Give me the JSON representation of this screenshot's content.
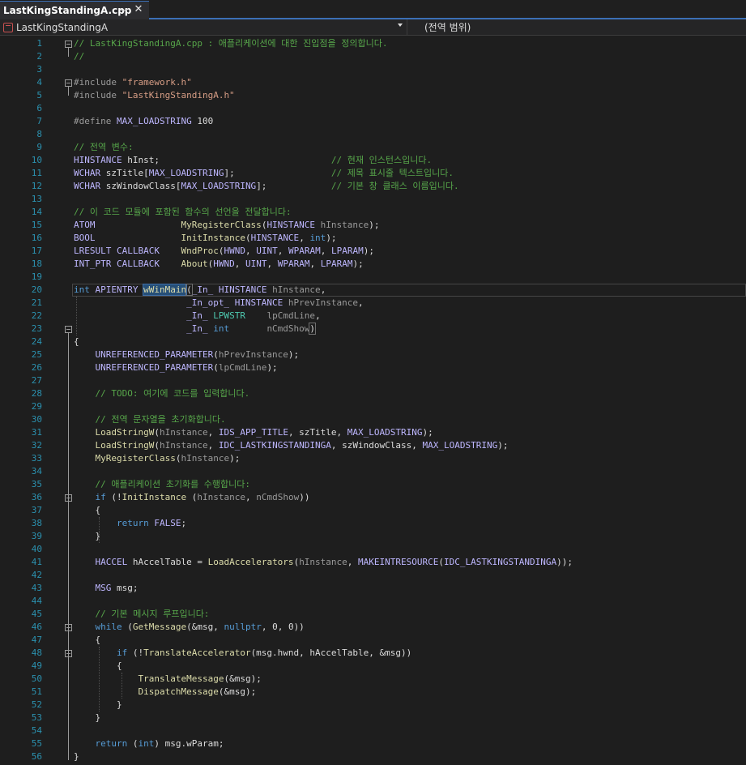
{
  "tab": {
    "label": "LastKingStandingA.cpp",
    "pin_icon": "pin-icon",
    "close_icon": "close-icon"
  },
  "navbar": {
    "project": "LastKingStandingA",
    "scope": "(전역 범위)"
  },
  "colors": {
    "comment": "#57a64a",
    "keyword": "#569cd6",
    "type": "#4ec9b0",
    "function": "#dcdcaa",
    "macro": "#beb7ff",
    "string": "#d69d85",
    "param": "#9a9a9a",
    "line_number": "#2b91af",
    "background": "#1e1e1e"
  },
  "lines": [
    {
      "n": "1",
      "fold": true,
      "parts": [
        [
          "c",
          "// LastKingStandingA.cpp : 애플리케이션에 대한 진입점을 정의합니다."
        ]
      ]
    },
    {
      "n": "2",
      "parts": [
        [
          "c",
          "//"
        ]
      ]
    },
    {
      "n": "3",
      "parts": []
    },
    {
      "n": "4",
      "fold": true,
      "parts": [
        [
          "pp",
          "#include "
        ],
        [
          "s",
          "\"framework.h\""
        ]
      ]
    },
    {
      "n": "5",
      "parts": [
        [
          "pp",
          "#include "
        ],
        [
          "s",
          "\"LastKingStandingA.h\""
        ]
      ]
    },
    {
      "n": "6",
      "parts": []
    },
    {
      "n": "7",
      "parts": [
        [
          "pp",
          "#define "
        ],
        [
          "m",
          "MAX_LOADSTRING"
        ],
        [
          "p",
          " 100"
        ]
      ]
    },
    {
      "n": "8",
      "parts": []
    },
    {
      "n": "9",
      "parts": [
        [
          "c",
          "// 전역 변수:"
        ]
      ]
    },
    {
      "n": "10",
      "parts": [
        [
          "m",
          "HINSTANCE"
        ],
        [
          "p",
          " hInst;                                "
        ],
        [
          "c",
          "// 현재 인스턴스입니다."
        ]
      ]
    },
    {
      "n": "11",
      "parts": [
        [
          "m",
          "WCHAR"
        ],
        [
          "p",
          " szTitle["
        ],
        [
          "m",
          "MAX_LOADSTRING"
        ],
        [
          "p",
          "];                  "
        ],
        [
          "c",
          "// 제목 표시줄 텍스트입니다."
        ]
      ]
    },
    {
      "n": "12",
      "parts": [
        [
          "m",
          "WCHAR"
        ],
        [
          "p",
          " szWindowClass["
        ],
        [
          "m",
          "MAX_LOADSTRING"
        ],
        [
          "p",
          "];            "
        ],
        [
          "c",
          "// 기본 창 클래스 이름입니다."
        ]
      ]
    },
    {
      "n": "13",
      "parts": []
    },
    {
      "n": "14",
      "parts": [
        [
          "c",
          "// 이 코드 모듈에 포함된 함수의 선언을 전달합니다:"
        ]
      ]
    },
    {
      "n": "15",
      "parts": [
        [
          "m",
          "ATOM"
        ],
        [
          "p",
          "                "
        ],
        [
          "f",
          "MyRegisterClass"
        ],
        [
          "p",
          "("
        ],
        [
          "m",
          "HINSTANCE"
        ],
        [
          "p",
          " "
        ],
        [
          "a",
          "hInstance"
        ],
        [
          "p",
          ");"
        ]
      ]
    },
    {
      "n": "16",
      "parts": [
        [
          "m",
          "BOOL"
        ],
        [
          "p",
          "                "
        ],
        [
          "f",
          "InitInstance"
        ],
        [
          "p",
          "("
        ],
        [
          "m",
          "HINSTANCE"
        ],
        [
          "p",
          ", "
        ],
        [
          "k",
          "int"
        ],
        [
          "p",
          ");"
        ]
      ]
    },
    {
      "n": "17",
      "parts": [
        [
          "m",
          "LRESULT"
        ],
        [
          "p",
          " "
        ],
        [
          "m",
          "CALLBACK"
        ],
        [
          "p",
          "    "
        ],
        [
          "f",
          "WndProc"
        ],
        [
          "p",
          "("
        ],
        [
          "m",
          "HWND"
        ],
        [
          "p",
          ", "
        ],
        [
          "m",
          "UINT"
        ],
        [
          "p",
          ", "
        ],
        [
          "m",
          "WPARAM"
        ],
        [
          "p",
          ", "
        ],
        [
          "m",
          "LPARAM"
        ],
        [
          "p",
          ");"
        ]
      ]
    },
    {
      "n": "18",
      "parts": [
        [
          "m",
          "INT_PTR"
        ],
        [
          "p",
          " "
        ],
        [
          "m",
          "CALLBACK"
        ],
        [
          "p",
          "    "
        ],
        [
          "f",
          "About"
        ],
        [
          "p",
          "("
        ],
        [
          "m",
          "HWND"
        ],
        [
          "p",
          ", "
        ],
        [
          "m",
          "UINT"
        ],
        [
          "p",
          ", "
        ],
        [
          "m",
          "WPARAM"
        ],
        [
          "p",
          ", "
        ],
        [
          "m",
          "LPARAM"
        ],
        [
          "p",
          ");"
        ]
      ]
    },
    {
      "n": "19",
      "parts": []
    },
    {
      "n": "20",
      "parts": [
        [
          "k",
          "int"
        ],
        [
          "p",
          " "
        ],
        [
          "m",
          "APIENTRY"
        ],
        [
          "p",
          " "
        ],
        [
          "fsel",
          "wWinMain"
        ],
        [
          "pb",
          "("
        ],
        [
          "m",
          "_In_"
        ],
        [
          "p",
          " "
        ],
        [
          "m",
          "HINSTANCE"
        ],
        [
          "p",
          " "
        ],
        [
          "a",
          "hInstance"
        ],
        [
          "p",
          ","
        ]
      ]
    },
    {
      "n": "21",
      "parts": [
        [
          "p",
          "                     "
        ],
        [
          "m",
          "_In_opt_"
        ],
        [
          "p",
          " "
        ],
        [
          "m",
          "HINSTANCE"
        ],
        [
          "p",
          " "
        ],
        [
          "a",
          "hPrevInstance"
        ],
        [
          "p",
          ","
        ]
      ]
    },
    {
      "n": "22",
      "parts": [
        [
          "p",
          "                     "
        ],
        [
          "m",
          "_In_"
        ],
        [
          "p",
          " "
        ],
        [
          "t",
          "LPWSTR"
        ],
        [
          "p",
          "    "
        ],
        [
          "a",
          "lpCmdLine"
        ],
        [
          "p",
          ","
        ]
      ]
    },
    {
      "n": "23",
      "fold": true,
      "parts": [
        [
          "p",
          "                     "
        ],
        [
          "m",
          "_In_"
        ],
        [
          "p",
          " "
        ],
        [
          "k",
          "int"
        ],
        [
          "p",
          "       "
        ],
        [
          "a",
          "nCmdShow"
        ],
        [
          "pb",
          ")"
        ]
      ]
    },
    {
      "n": "24",
      "parts": [
        [
          "p",
          "{"
        ]
      ]
    },
    {
      "n": "25",
      "parts": [
        [
          "p",
          "    "
        ],
        [
          "m",
          "UNREFERENCED_PARAMETER"
        ],
        [
          "p",
          "("
        ],
        [
          "a",
          "hPrevInstance"
        ],
        [
          "p",
          ");"
        ]
      ]
    },
    {
      "n": "26",
      "parts": [
        [
          "p",
          "    "
        ],
        [
          "m",
          "UNREFERENCED_PARAMETER"
        ],
        [
          "p",
          "("
        ],
        [
          "a",
          "lpCmdLine"
        ],
        [
          "p",
          ");"
        ]
      ]
    },
    {
      "n": "27",
      "parts": []
    },
    {
      "n": "28",
      "parts": [
        [
          "p",
          "    "
        ],
        [
          "c",
          "// TODO: 여기에 코드를 입력합니다."
        ]
      ]
    },
    {
      "n": "29",
      "parts": []
    },
    {
      "n": "30",
      "parts": [
        [
          "p",
          "    "
        ],
        [
          "c",
          "// 전역 문자열을 초기화합니다."
        ]
      ]
    },
    {
      "n": "31",
      "parts": [
        [
          "p",
          "    "
        ],
        [
          "f",
          "LoadStringW"
        ],
        [
          "p",
          "("
        ],
        [
          "a",
          "hInstance"
        ],
        [
          "p",
          ", "
        ],
        [
          "m",
          "IDS_APP_TITLE"
        ],
        [
          "p",
          ", szTitle, "
        ],
        [
          "m",
          "MAX_LOADSTRING"
        ],
        [
          "p",
          ");"
        ]
      ]
    },
    {
      "n": "32",
      "parts": [
        [
          "p",
          "    "
        ],
        [
          "f",
          "LoadStringW"
        ],
        [
          "p",
          "("
        ],
        [
          "a",
          "hInstance"
        ],
        [
          "p",
          ", "
        ],
        [
          "m",
          "IDC_LASTKINGSTANDINGA"
        ],
        [
          "p",
          ", szWindowClass, "
        ],
        [
          "m",
          "MAX_LOADSTRING"
        ],
        [
          "p",
          ");"
        ]
      ]
    },
    {
      "n": "33",
      "parts": [
        [
          "p",
          "    "
        ],
        [
          "f",
          "MyRegisterClass"
        ],
        [
          "p",
          "("
        ],
        [
          "a",
          "hInstance"
        ],
        [
          "p",
          ");"
        ]
      ]
    },
    {
      "n": "34",
      "parts": []
    },
    {
      "n": "35",
      "parts": [
        [
          "p",
          "    "
        ],
        [
          "c",
          "// 애플리케이션 초기화를 수행합니다:"
        ]
      ]
    },
    {
      "n": "36",
      "fold": true,
      "parts": [
        [
          "p",
          "    "
        ],
        [
          "k",
          "if"
        ],
        [
          "p",
          " (!"
        ],
        [
          "f",
          "InitInstance"
        ],
        [
          "p",
          " ("
        ],
        [
          "a",
          "hInstance"
        ],
        [
          "p",
          ", "
        ],
        [
          "a",
          "nCmdShow"
        ],
        [
          "p",
          "))"
        ]
      ]
    },
    {
      "n": "37",
      "parts": [
        [
          "p",
          "    {"
        ]
      ]
    },
    {
      "n": "38",
      "parts": [
        [
          "p",
          "        "
        ],
        [
          "k",
          "return"
        ],
        [
          "p",
          " "
        ],
        [
          "m",
          "FALSE"
        ],
        [
          "p",
          ";"
        ]
      ]
    },
    {
      "n": "39",
      "parts": [
        [
          "p",
          "    }"
        ]
      ]
    },
    {
      "n": "40",
      "parts": []
    },
    {
      "n": "41",
      "parts": [
        [
          "p",
          "    "
        ],
        [
          "m",
          "HACCEL"
        ],
        [
          "p",
          " hAccelTable = "
        ],
        [
          "f",
          "LoadAccelerators"
        ],
        [
          "p",
          "("
        ],
        [
          "a",
          "hInstance"
        ],
        [
          "p",
          ", "
        ],
        [
          "m",
          "MAKEINTRESOURCE"
        ],
        [
          "p",
          "("
        ],
        [
          "m",
          "IDC_LASTKINGSTANDINGA"
        ],
        [
          "p",
          "));"
        ]
      ]
    },
    {
      "n": "42",
      "parts": []
    },
    {
      "n": "43",
      "parts": [
        [
          "p",
          "    "
        ],
        [
          "m",
          "MSG"
        ],
        [
          "p",
          " msg;"
        ]
      ]
    },
    {
      "n": "44",
      "parts": []
    },
    {
      "n": "45",
      "parts": [
        [
          "p",
          "    "
        ],
        [
          "c",
          "// 기본 메시지 루프입니다:"
        ]
      ]
    },
    {
      "n": "46",
      "fold": true,
      "parts": [
        [
          "p",
          "    "
        ],
        [
          "k",
          "while"
        ],
        [
          "p",
          " ("
        ],
        [
          "f",
          "GetMessage"
        ],
        [
          "p",
          "(&msg, "
        ],
        [
          "k",
          "nullptr"
        ],
        [
          "p",
          ", 0, 0))"
        ]
      ]
    },
    {
      "n": "47",
      "parts": [
        [
          "p",
          "    {"
        ]
      ]
    },
    {
      "n": "48",
      "fold": true,
      "parts": [
        [
          "p",
          "        "
        ],
        [
          "k",
          "if"
        ],
        [
          "p",
          " (!"
        ],
        [
          "f",
          "TranslateAccelerator"
        ],
        [
          "p",
          "(msg.hwnd, hAccelTable, &msg))"
        ]
      ]
    },
    {
      "n": "49",
      "parts": [
        [
          "p",
          "        {"
        ]
      ]
    },
    {
      "n": "50",
      "parts": [
        [
          "p",
          "            "
        ],
        [
          "f",
          "TranslateMessage"
        ],
        [
          "p",
          "(&msg);"
        ]
      ]
    },
    {
      "n": "51",
      "parts": [
        [
          "p",
          "            "
        ],
        [
          "f",
          "DispatchMessage"
        ],
        [
          "p",
          "(&msg);"
        ]
      ]
    },
    {
      "n": "52",
      "parts": [
        [
          "p",
          "        }"
        ]
      ]
    },
    {
      "n": "53",
      "parts": [
        [
          "p",
          "    }"
        ]
      ]
    },
    {
      "n": "54",
      "parts": []
    },
    {
      "n": "55",
      "parts": [
        [
          "p",
          "    "
        ],
        [
          "k",
          "return"
        ],
        [
          "p",
          " ("
        ],
        [
          "k",
          "int"
        ],
        [
          "p",
          ") msg.wParam;"
        ]
      ]
    },
    {
      "n": "56",
      "parts": [
        [
          "p",
          "}"
        ]
      ]
    }
  ]
}
